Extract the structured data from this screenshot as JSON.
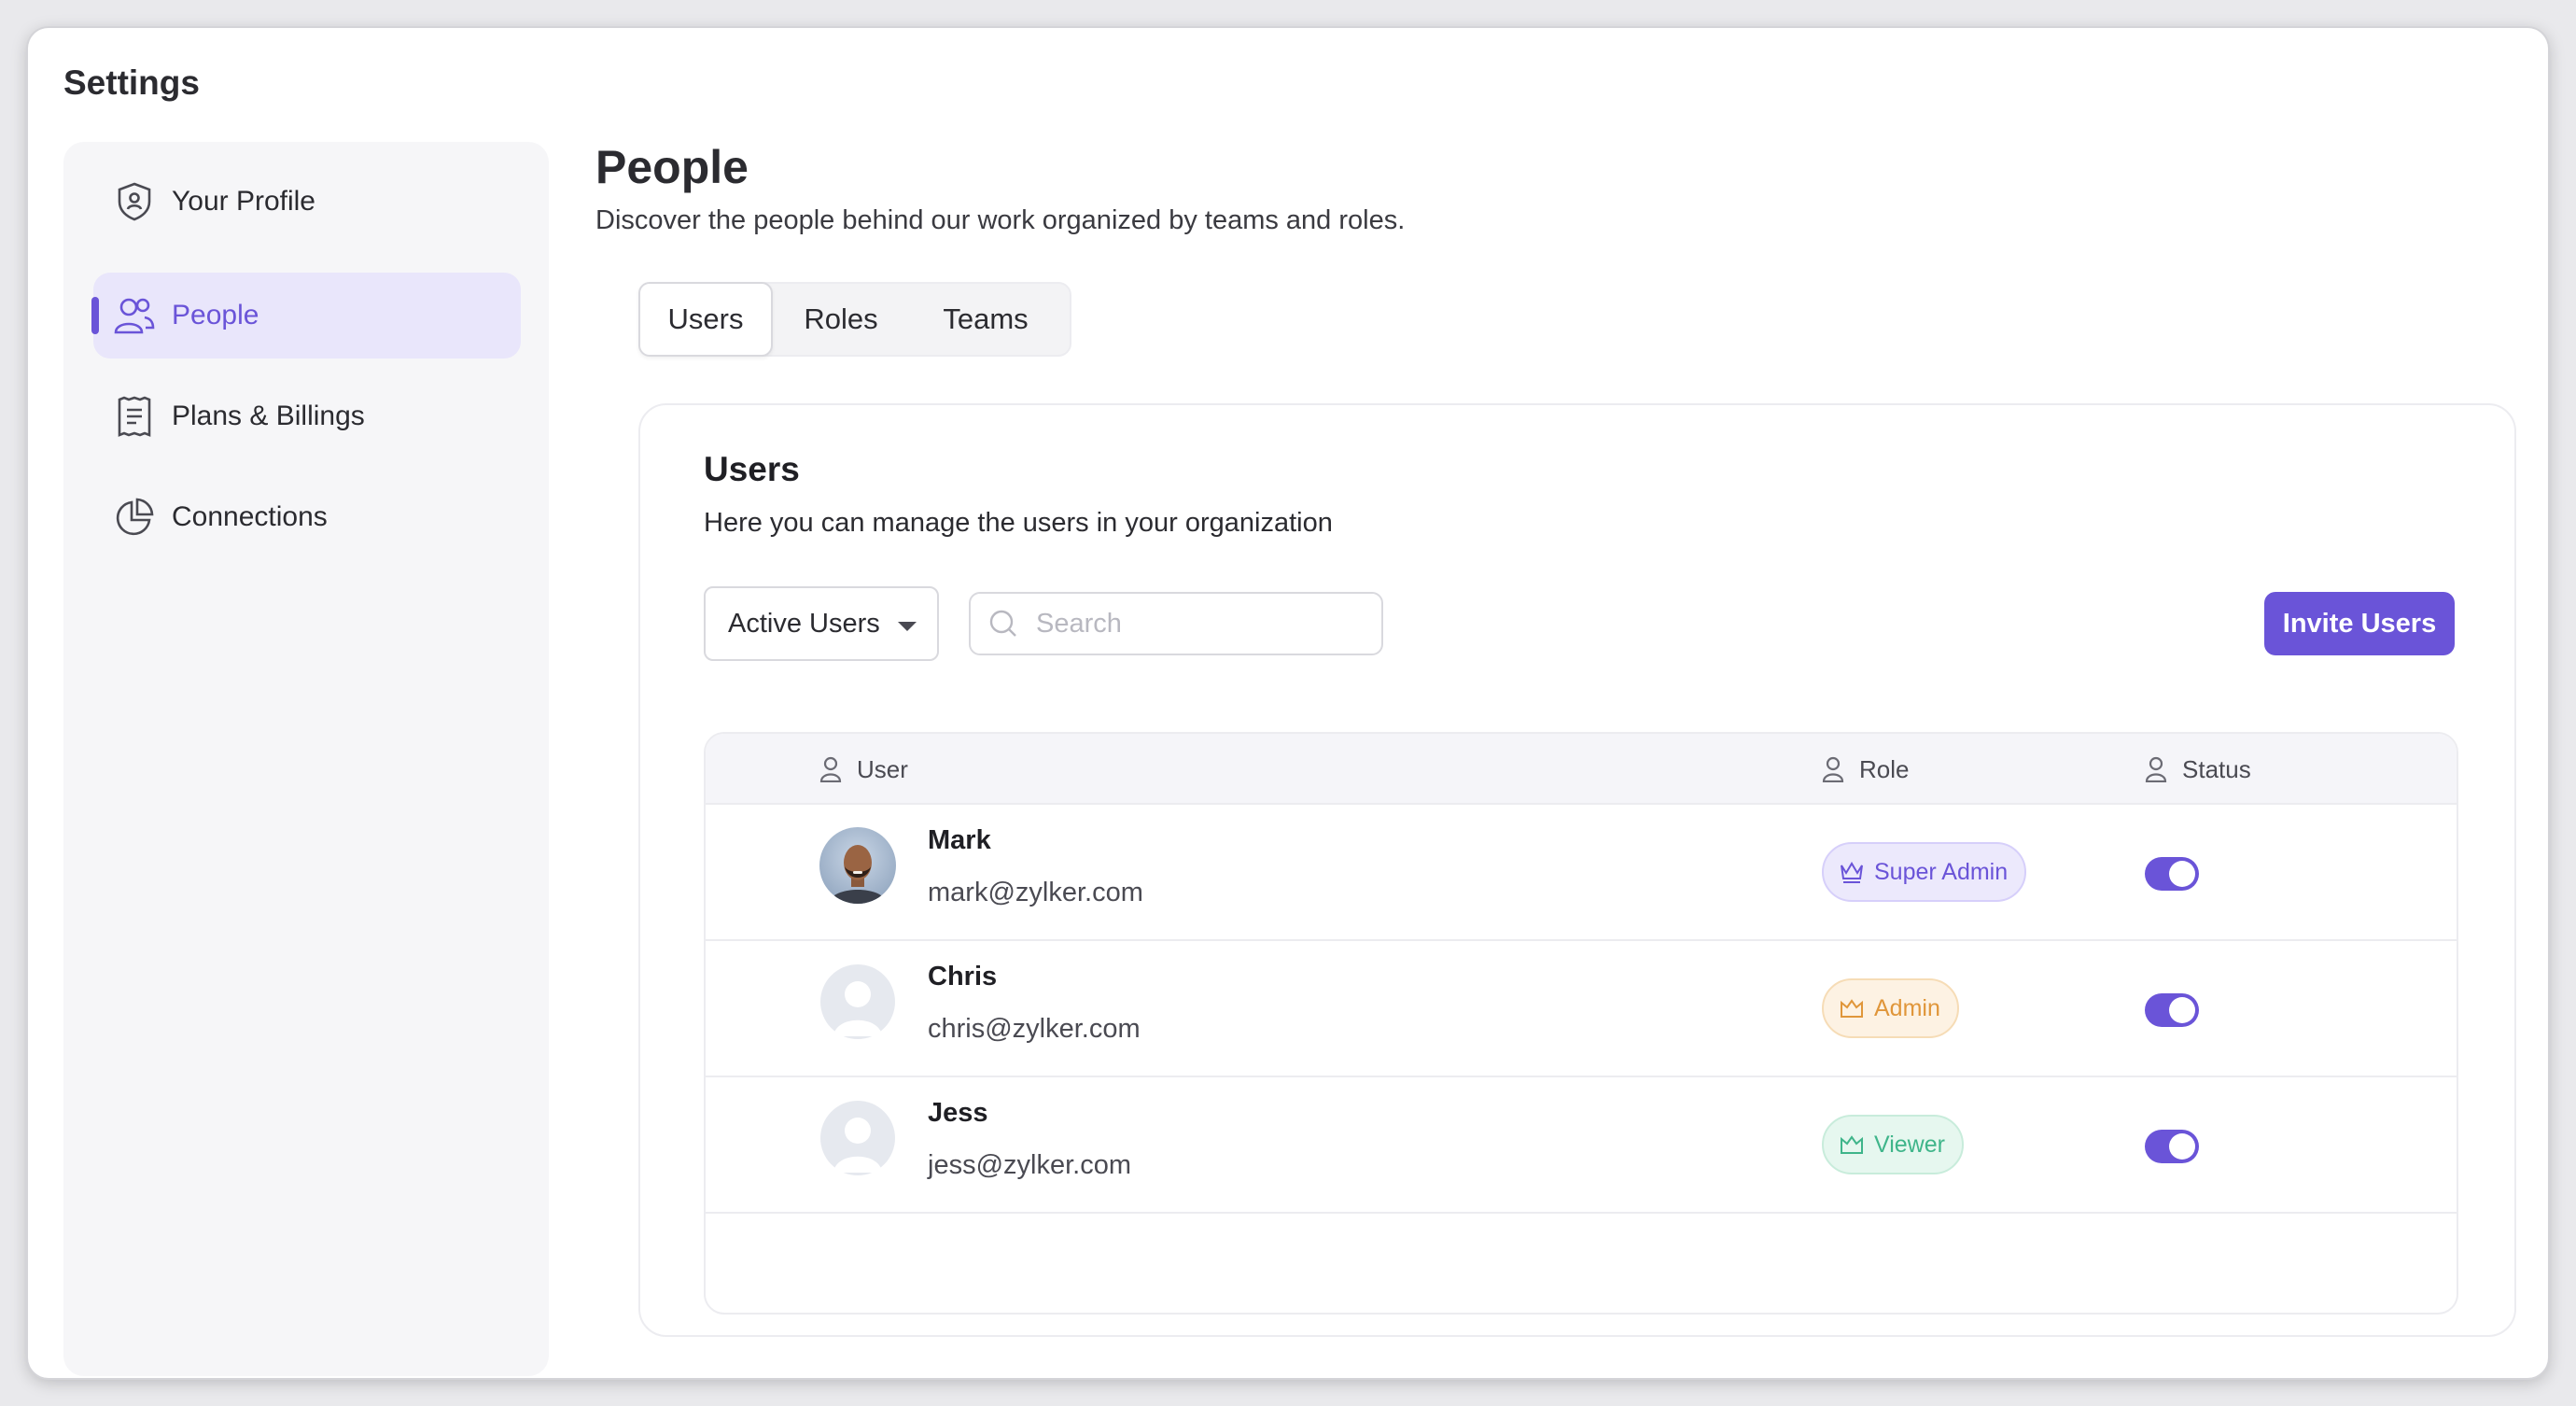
{
  "app": {
    "title": "Settings"
  },
  "sidebar": {
    "items": [
      {
        "label": "Your Profile",
        "icon": "shield-user-icon",
        "active": false
      },
      {
        "label": "People",
        "icon": "users-icon",
        "active": true
      },
      {
        "label": "Plans & Billings",
        "icon": "receipt-icon",
        "active": false
      },
      {
        "label": "Connections",
        "icon": "pie-chart-icon",
        "active": false
      }
    ]
  },
  "page": {
    "title": "People",
    "subtitle": "Discover the people behind our work organized by teams and roles."
  },
  "tabs": [
    {
      "label": "Users",
      "active": true
    },
    {
      "label": "Roles",
      "active": false
    },
    {
      "label": "Teams",
      "active": false
    }
  ],
  "users_panel": {
    "title": "Users",
    "subtitle": "Here you can manage the users in your organization",
    "filter": {
      "selected": "Active Users"
    },
    "search": {
      "placeholder": "Search",
      "value": ""
    },
    "invite_label": "Invite Users",
    "table": {
      "columns": [
        "User",
        "Role",
        "Status"
      ],
      "rows": [
        {
          "name": "Mark",
          "email": "mark@zylker.com",
          "role": "Super Admin",
          "role_color": "#6a54d8",
          "role_bg": "#ece9fc",
          "role_border": "#d6cffa",
          "status_on": true,
          "avatar": "photo"
        },
        {
          "name": "Chris",
          "email": "chris@zylker.com",
          "role": "Admin",
          "role_color": "#e0963a",
          "role_bg": "#fdf2e3",
          "role_border": "#f6dcb6",
          "status_on": true,
          "avatar": "placeholder"
        },
        {
          "name": "Jess",
          "email": "jess@zylker.com",
          "role": "Viewer",
          "role_color": "#3fb58a",
          "role_bg": "#e6f7ef",
          "role_border": "#c8ecdb",
          "status_on": true,
          "avatar": "placeholder"
        }
      ]
    }
  },
  "colors": {
    "accent": "#6a54d8"
  }
}
